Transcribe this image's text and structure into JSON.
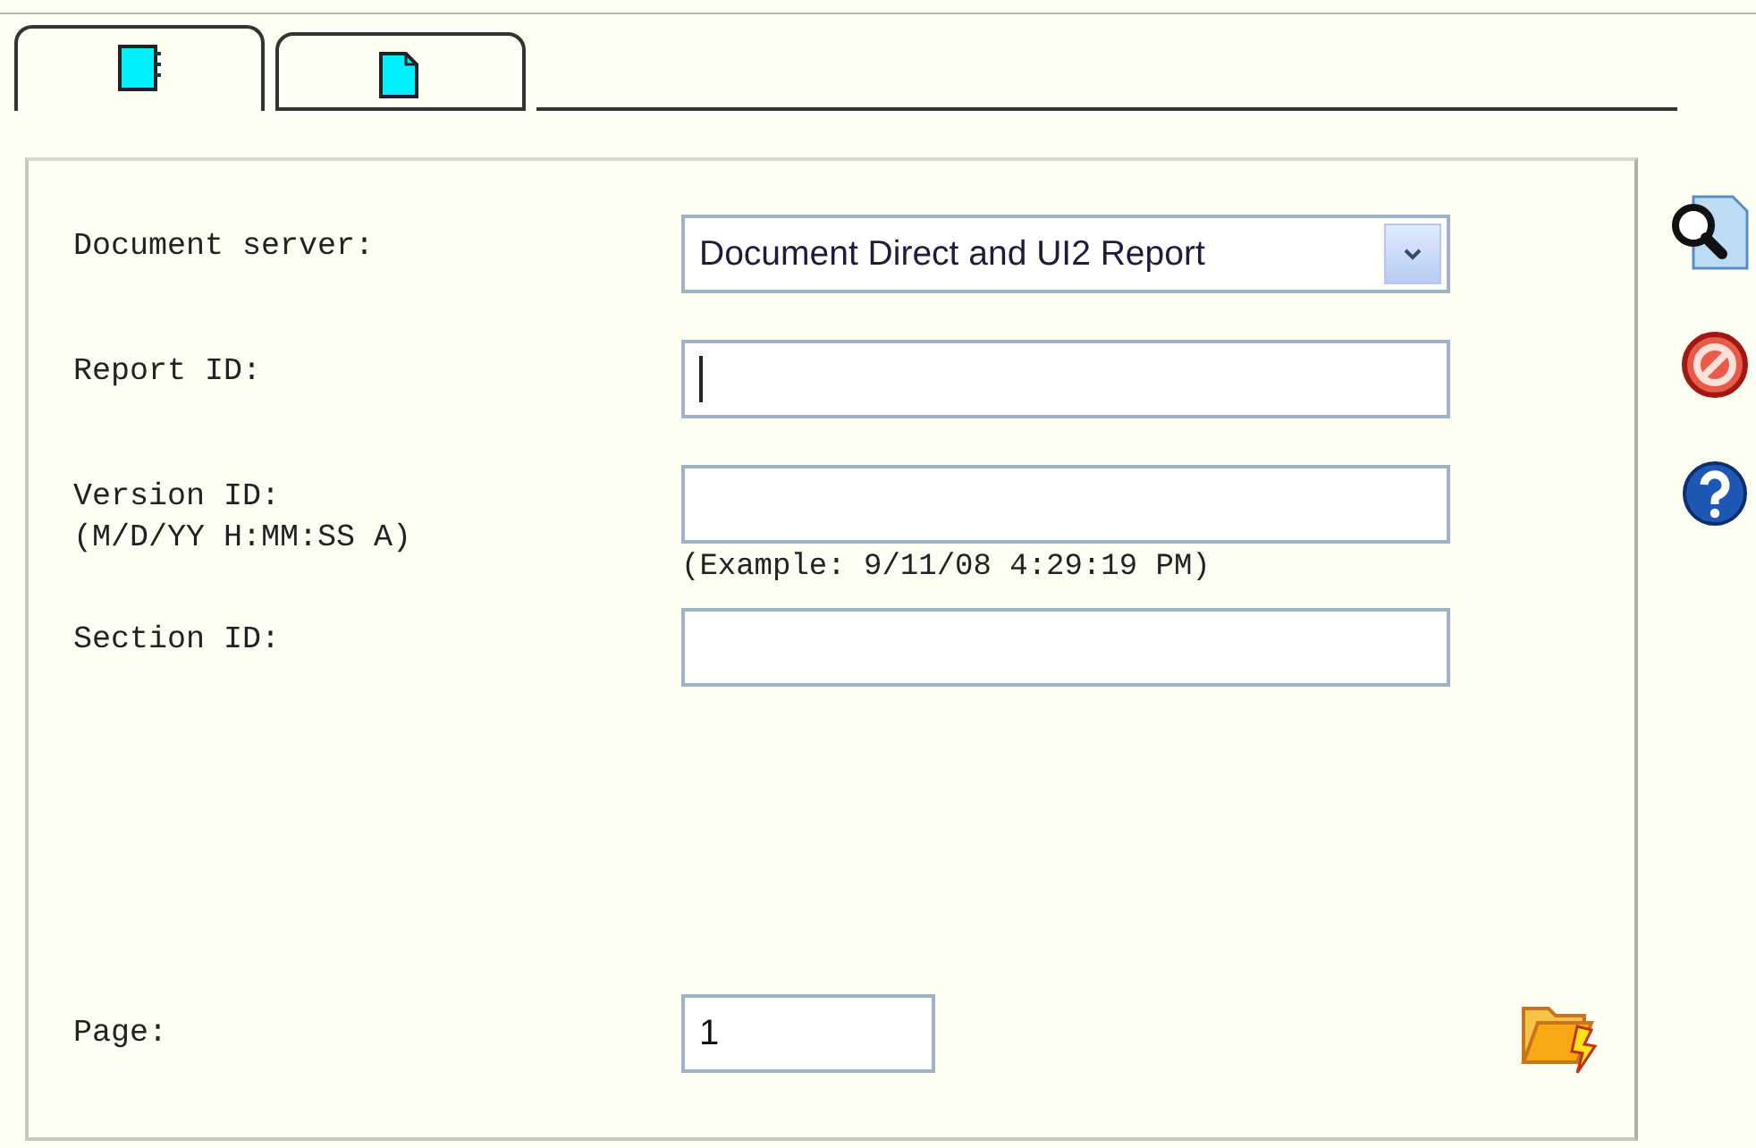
{
  "tabs": [
    {
      "kind": "book",
      "selected": true
    },
    {
      "kind": "page",
      "selected": false
    }
  ],
  "fields": [
    {
      "kind": "select",
      "label": "Document server:",
      "value": "Document Direct and UI2 Report"
    },
    {
      "kind": "text",
      "label": "Report ID:",
      "focused": true
    },
    {
      "kind": "text",
      "label": "Version ID:",
      "sublabel": "(M/D/YY H:MM:SS A)",
      "hint": "(Example: 9/11/08 4:29:19 PM)",
      "focused": false
    },
    {
      "kind": "text",
      "label": "Section ID:",
      "focused": false
    }
  ],
  "page": {
    "label": "Page:",
    "value": "1"
  }
}
